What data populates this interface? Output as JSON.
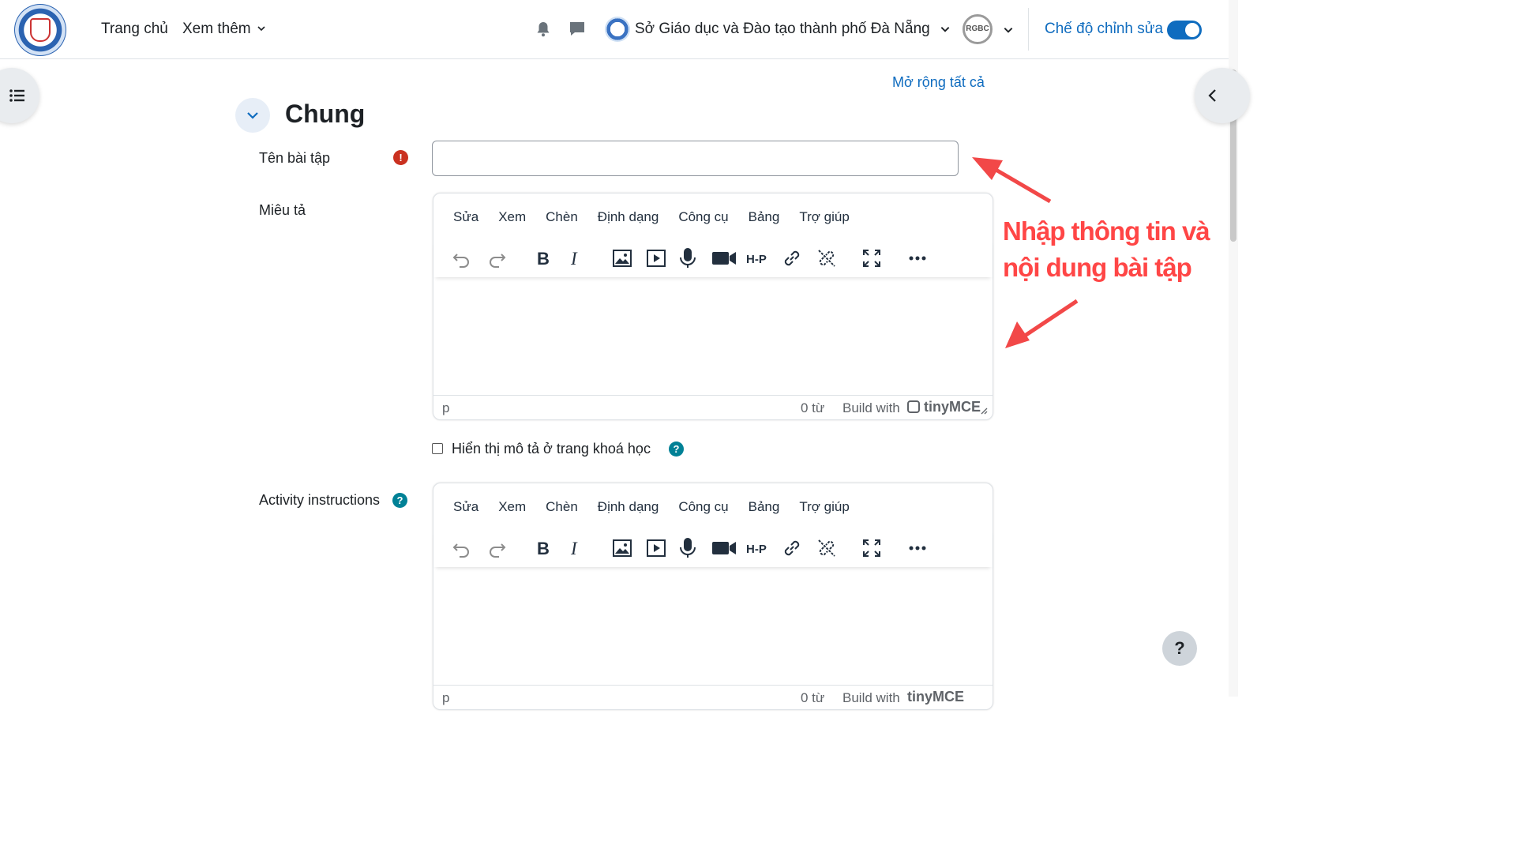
{
  "header": {
    "nav": [
      "Trang chủ",
      "Xem thêm"
    ],
    "school_name": "Sở Giáo dục và Đào tạo thành phố Đà Nẵng",
    "user_initials": "RGBC",
    "edit_mode_label": "Chế độ chỉnh sửa",
    "edit_mode_on": true
  },
  "page": {
    "expand_all": "Mở rộng tất cả",
    "section_title": "Chung",
    "name_label": "Tên bài tập",
    "description_label": "Miêu tả",
    "show_description_label": "Hiển thị mô tả ở trang khoá học",
    "instructions_label": "Activity instructions"
  },
  "editor": {
    "menu": [
      "Sửa",
      "Xem",
      "Chèn",
      "Định dạng",
      "Công cụ",
      "Bảng",
      "Trợ giúp"
    ],
    "path": "p",
    "word_count": "0 từ",
    "build_with": "Build with",
    "brand": "tinyMCE",
    "toolbar_icons": [
      "undo-icon",
      "redo-icon",
      "bold-icon",
      "italic-icon",
      "image-icon",
      "media-icon",
      "microphone-icon",
      "video-camera-icon",
      "h5p-icon",
      "link-icon",
      "unlink-icon",
      "fullscreen-icon",
      "more-icon"
    ],
    "h5p_text": "H-P"
  },
  "annotation": {
    "line1": "Nhập thông tin và",
    "line2": "nội dung bài tập",
    "color": "#ff4646"
  },
  "help_button": "?",
  "accent": "#0f6cbf"
}
